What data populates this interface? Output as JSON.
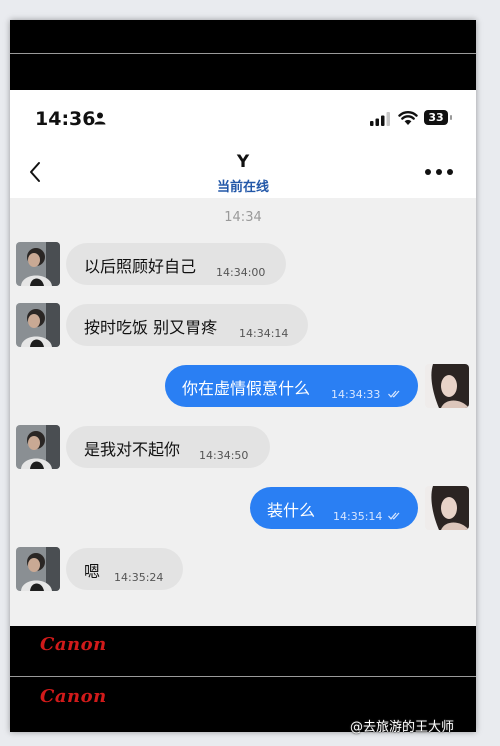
{
  "status_bar": {
    "time": "14:36",
    "battery": "33",
    "icons": [
      "person-icon",
      "signal-icon",
      "wifi-icon",
      "battery-icon"
    ]
  },
  "header": {
    "name": "Y",
    "status": "当前在线",
    "icons": [
      "back-chevron-icon",
      "more-dots-icon"
    ]
  },
  "chat": {
    "date_separator": "14:34",
    "messages": [
      {
        "side": "in",
        "text": "以后照顾好自己",
        "time": "14:34:00"
      },
      {
        "side": "in",
        "text": "按时吃饭 别又胃疼",
        "time": "14:34:14"
      },
      {
        "side": "out",
        "text": "你在虚情假意什么",
        "time": "14:34:33"
      },
      {
        "side": "in",
        "text": "是我对不起你",
        "time": "14:34:50"
      },
      {
        "side": "out",
        "text": "装什么",
        "time": "14:35:14"
      },
      {
        "side": "in",
        "text": "嗯",
        "time": "14:35:24"
      }
    ]
  },
  "branding": {
    "logo_top": "Canon",
    "logo_bottom": "Canon"
  },
  "watermark": "@去旅游的王大师",
  "colors": {
    "outgoing_bubble": "#2a7ff3",
    "incoming_bubble": "#e3e3e3",
    "online_status": "#2257a8",
    "brand_red": "#d11a1a"
  }
}
